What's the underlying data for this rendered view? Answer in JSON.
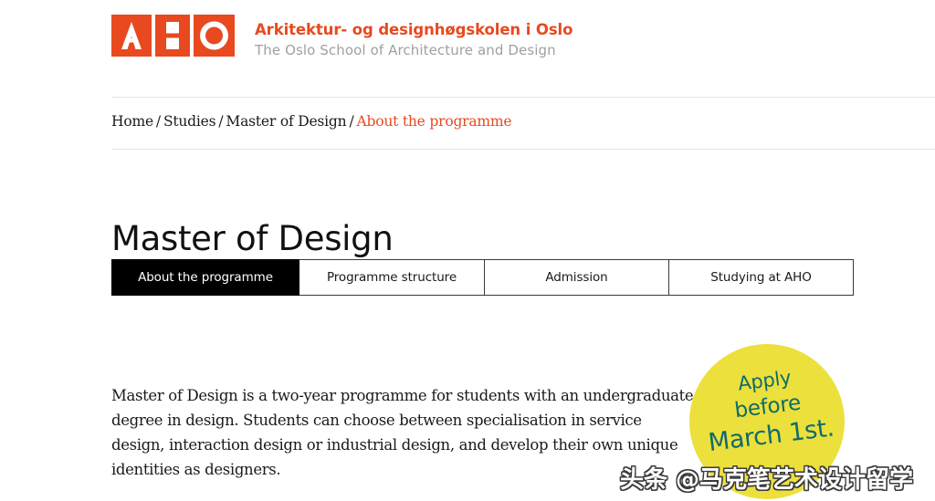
{
  "colors": {
    "brand_orange": "#e8491f",
    "badge_yellow": "#ece03c",
    "badge_text_teal": "#0f6b6b",
    "active_tab_bg": "#000000",
    "rule_gray": "#e2e2e2",
    "subtitle_gray": "#a0a0a0"
  },
  "header": {
    "logo_icon": "aho-logo-mark",
    "logo_alt": "AHO",
    "title_no": "Arkitektur- og designhøgskolen i Oslo",
    "title_en": "The Oslo School of Architecture and Design"
  },
  "breadcrumb": {
    "items": [
      {
        "label": "Home",
        "current": false
      },
      {
        "label": "Studies",
        "current": false
      },
      {
        "label": "Master of Design",
        "current": false
      },
      {
        "label": "About the programme",
        "current": true
      }
    ],
    "separator": "/"
  },
  "main": {
    "page_title": "Master of Design",
    "tabs": [
      {
        "label": "About the programme",
        "active": true
      },
      {
        "label": "Programme structure",
        "active": false
      },
      {
        "label": "Admission",
        "active": false
      },
      {
        "label": "Studying at AHO",
        "active": false
      }
    ],
    "intro_paragraph": "Master of Design is a two-year programme for students with an undergraduate degree in design. Students can choose between specialisation in service design, interaction design or industrial design, and develop their own unique identities as designers."
  },
  "apply_badge": {
    "line1": "Apply",
    "line2": "before",
    "line3": "March 1st."
  },
  "watermark": {
    "text": "头条 @马克笔艺术设计留学"
  }
}
